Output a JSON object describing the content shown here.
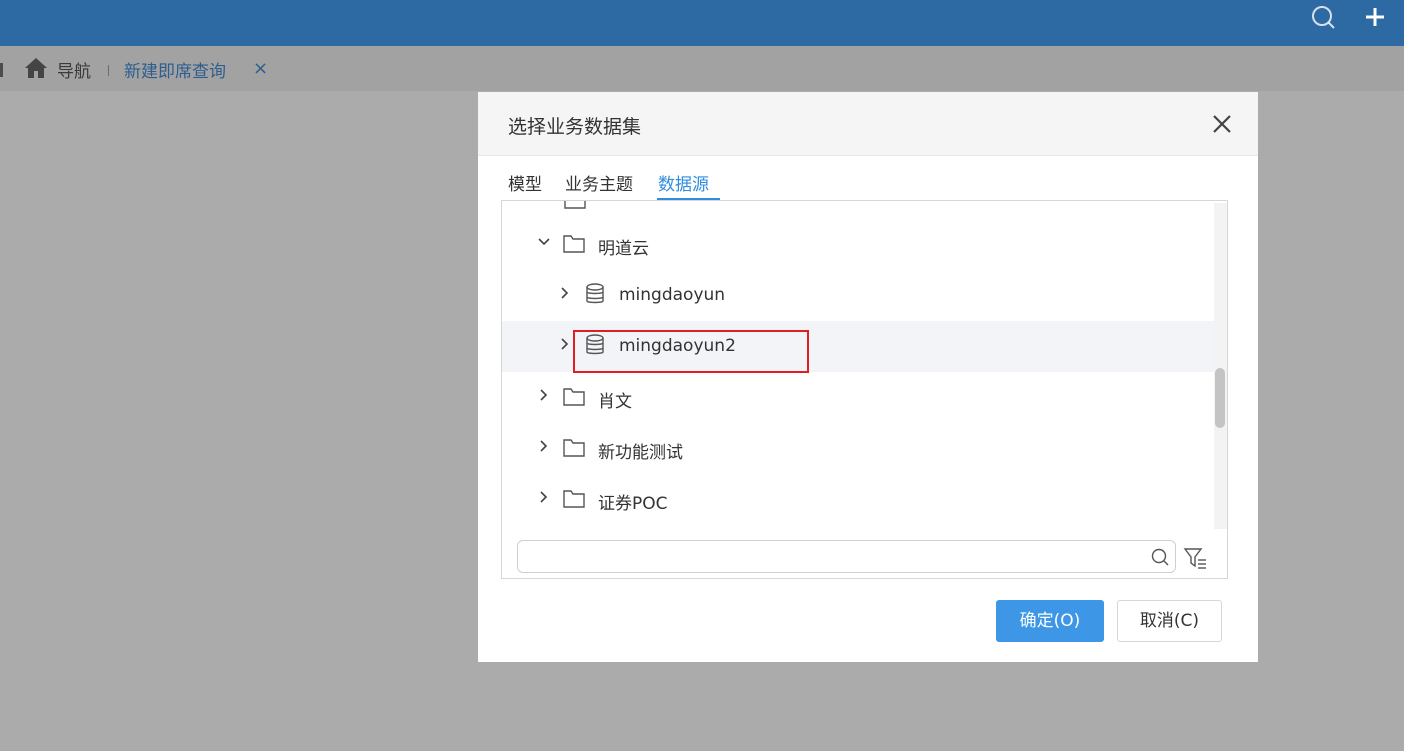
{
  "topbar": {
    "search_icon": "search-icon",
    "add_icon": "plus-icon",
    "background": "#2d6aa3"
  },
  "tabbar": {
    "home_icon": "home-icon",
    "nav_label": "导航",
    "active_tab_label": "新建即席查询",
    "close_label": "×"
  },
  "dialog": {
    "title": "选择业务数据集",
    "tabs": [
      {
        "label": "模型",
        "active": false
      },
      {
        "label": "业务主题",
        "active": false
      },
      {
        "label": "数据源",
        "active": true
      }
    ],
    "tree": {
      "items": [
        {
          "label": "明道云",
          "type": "folder",
          "expanded": true,
          "level": 1
        },
        {
          "label": "mingdaoyun",
          "type": "database",
          "expanded": false,
          "level": 2
        },
        {
          "label": "mingdaoyun2",
          "type": "database",
          "expanded": false,
          "level": 2,
          "highlighted": true
        },
        {
          "label": "肖文",
          "type": "folder",
          "expanded": false,
          "level": 1
        },
        {
          "label": "新功能测试",
          "type": "folder",
          "expanded": false,
          "level": 1
        },
        {
          "label": "证券POC",
          "type": "folder",
          "expanded": false,
          "level": 1
        }
      ]
    },
    "search": {
      "value": "",
      "placeholder": ""
    },
    "buttons": {
      "ok_label": "确定(O)",
      "cancel_label": "取消(C)"
    },
    "accent_color": "#2f8de0",
    "annotation_color": "#e02020"
  }
}
